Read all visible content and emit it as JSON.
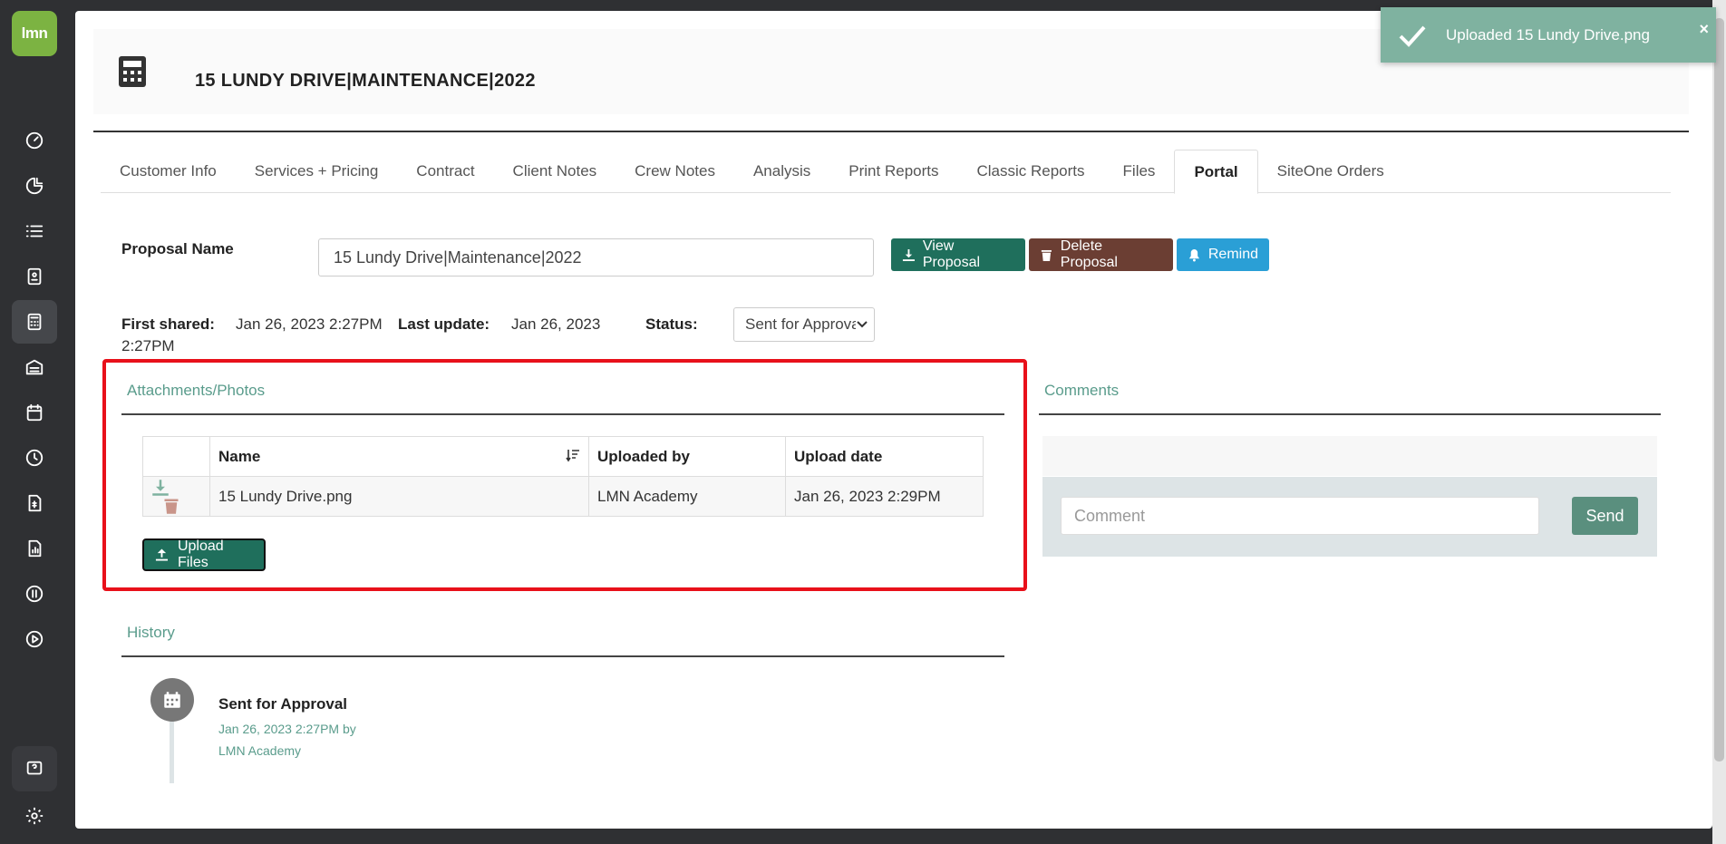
{
  "app": {
    "logo_text": "lmn"
  },
  "toast": {
    "message": "Uploaded 15 Lundy Drive.png",
    "close_label": "×"
  },
  "header": {
    "title": "15 LUNDY DRIVE|MAINTENANCE|2022"
  },
  "tabs": [
    {
      "label": "Customer Info"
    },
    {
      "label": "Services + Pricing"
    },
    {
      "label": "Contract"
    },
    {
      "label": "Client Notes"
    },
    {
      "label": "Crew Notes"
    },
    {
      "label": "Analysis"
    },
    {
      "label": "Print Reports"
    },
    {
      "label": "Classic Reports"
    },
    {
      "label": "Files"
    },
    {
      "label": "Portal",
      "active": true
    },
    {
      "label": "SiteOne Orders"
    }
  ],
  "proposal": {
    "name_label": "Proposal Name",
    "name_value": "15 Lundy Drive|Maintenance|2022",
    "view_button": "View Proposal",
    "delete_button": "Delete Proposal",
    "remind_button": "Remind",
    "first_shared_label": "First shared:",
    "first_shared_value_line1": "Jan 26, 2023 2:27PM",
    "first_shared_value_line2": "2:27PM",
    "last_update_label": "Last update:",
    "last_update_value": "Jan 26, 2023",
    "status_label": "Status:",
    "status_value": "Sent for Approval"
  },
  "attachments": {
    "title": "Attachments/Photos",
    "columns": {
      "name": "Name",
      "uploaded_by": "Uploaded by",
      "upload_date": "Upload date"
    },
    "rows": [
      {
        "name": "15 Lundy Drive.png",
        "uploaded_by": "LMN Academy",
        "upload_date": "Jan 26, 2023 2:29PM"
      }
    ],
    "upload_button": "Upload Files"
  },
  "comments": {
    "title": "Comments",
    "placeholder": "Comment",
    "send_button": "Send"
  },
  "history": {
    "title": "History",
    "entries": [
      {
        "title": "Sent for Approval",
        "meta_line1": "Jan 26, 2023 2:27PM by",
        "meta_line2": "LMN Academy"
      }
    ]
  },
  "colors": {
    "primary_green": "#1f6f5c",
    "danger_brown": "#6b3e33",
    "info_blue": "#2a9fd6",
    "accent_teal": "#5a9c8c",
    "highlight_red": "#e8101a",
    "logo_green": "#7cb342"
  }
}
